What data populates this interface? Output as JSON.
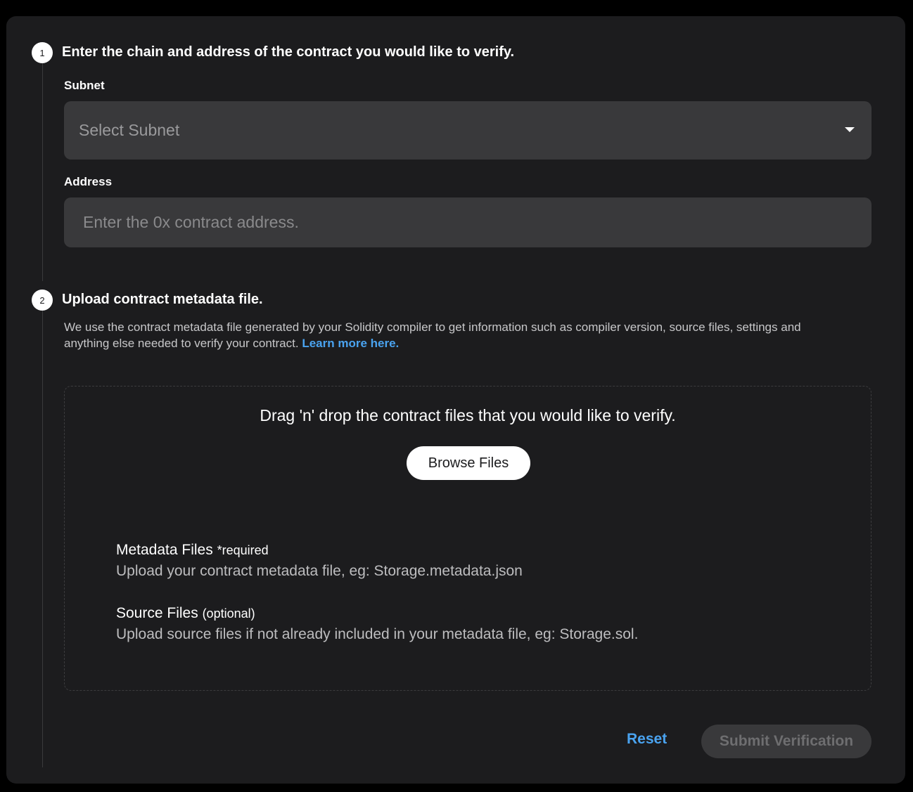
{
  "step1": {
    "number": "1",
    "title": "Enter the chain and address of the contract you would like to verify.",
    "subnet_label": "Subnet",
    "subnet_placeholder": "Select Subnet",
    "address_label": "Address",
    "address_placeholder": "Enter the 0x contract address.",
    "address_value": ""
  },
  "step2": {
    "number": "2",
    "title": "Upload contract metadata file.",
    "description": "We use the contract metadata file generated by your Solidity compiler to get information such as compiler version, source files, settings and anything else needed to verify your contract.",
    "learn_more": "Learn more here."
  },
  "dropzone": {
    "title": "Drag 'n' drop the contract files that you would like to verify.",
    "browse_label": "Browse Files",
    "metadata_title": "Metadata Files",
    "metadata_note": "*required",
    "metadata_desc": "Upload your contract metadata file, eg: Storage.metadata.json",
    "source_title": "Source Files",
    "source_note": "(optional)",
    "source_desc": "Upload source files if not already included in your metadata file, eg: Storage.sol."
  },
  "actions": {
    "reset_label": "Reset",
    "submit_label": "Submit Verification"
  },
  "colors": {
    "accent": "#4aa3f0",
    "card_bg": "#1c1c1e",
    "field_bg": "#39393b"
  }
}
